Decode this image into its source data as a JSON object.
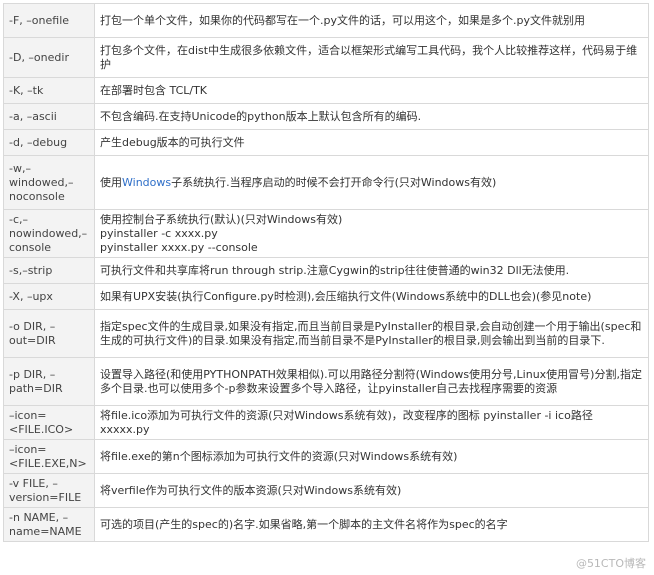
{
  "rows": [
    {
      "option": "-F, –onefile",
      "desc": "打包一个单个文件，如果你的代码都写在一个.py文件的话，可以用这个，如果是多个.py文件就别用"
    },
    {
      "option": "-D, –onedir",
      "desc": "打包多个文件，在dist中生成很多依赖文件，适合以框架形式编写工具代码，我个人比较推荐这样，代码易于维护"
    },
    {
      "option": "-K, –tk",
      "desc": "在部署时包含 TCL/TK"
    },
    {
      "option": "-a, –ascii",
      "desc": "不包含编码.在支持Unicode的python版本上默认包含所有的编码."
    },
    {
      "option": "-d, –debug",
      "desc": "产生debug版本的可执行文件"
    },
    {
      "option": "-w,–windowed,–noconsole",
      "desc_pre": "使用",
      "desc_link": "Windows",
      "desc_post": "子系统执行.当程序启动的时候不会打开命令行(只对Windows有效)"
    },
    {
      "option": "-c,–nowindowed,–console",
      "desc_lines": [
        "使用控制台子系统执行(默认)(只对Windows有效)",
        "pyinstaller -c  xxxx.py",
        "pyinstaller xxxx.py --console"
      ]
    },
    {
      "option": "-s,–strip",
      "desc": "可执行文件和共享库将run through strip.注意Cygwin的strip往往使普通的win32 Dll无法使用."
    },
    {
      "option": "-X, –upx",
      "desc": "如果有UPX安装(执行Configure.py时检测),会压缩执行文件(Windows系统中的DLL也会)(参见note)"
    },
    {
      "option": "-o DIR, –out=DIR",
      "desc": "指定spec文件的生成目录,如果没有指定,而且当前目录是PyInstaller的根目录,会自动创建一个用于输出(spec和生成的可执行文件)的目录.如果没有指定,而当前目录不是PyInstaller的根目录,则会输出到当前的目录下."
    },
    {
      "option": "-p DIR, –path=DIR",
      "desc": "设置导入路径(和使用PYTHONPATH效果相似).可以用路径分割符(Windows使用分号,Linux使用冒号)分割,指定多个目录.也可以使用多个-p参数来设置多个导入路径，让pyinstaller自己去找程序需要的资源"
    },
    {
      "option": "–icon=<FILE.ICO>",
      "desc": "将file.ico添加为可执行文件的资源(只对Windows系统有效)，改变程序的图标  pyinstaller -i  ico路径 xxxxx.py"
    },
    {
      "option": "–icon=<FILE.EXE,N>",
      "desc": "将file.exe的第n个图标添加为可执行文件的资源(只对Windows系统有效)"
    },
    {
      "option": "-v FILE, –version=FILE",
      "desc": "将verfile作为可执行文件的版本资源(只对Windows系统有效)"
    },
    {
      "option": "-n NAME, –name=NAME",
      "desc": "可选的项目(产生的spec的)名字.如果省略,第一个脚本的主文件名将作为spec的名字"
    }
  ],
  "watermark": "@51CTO博客",
  "colors": {
    "link": "#2f6fc8",
    "option_bg": "#f3f3f3",
    "border": "#d9d9d9"
  }
}
